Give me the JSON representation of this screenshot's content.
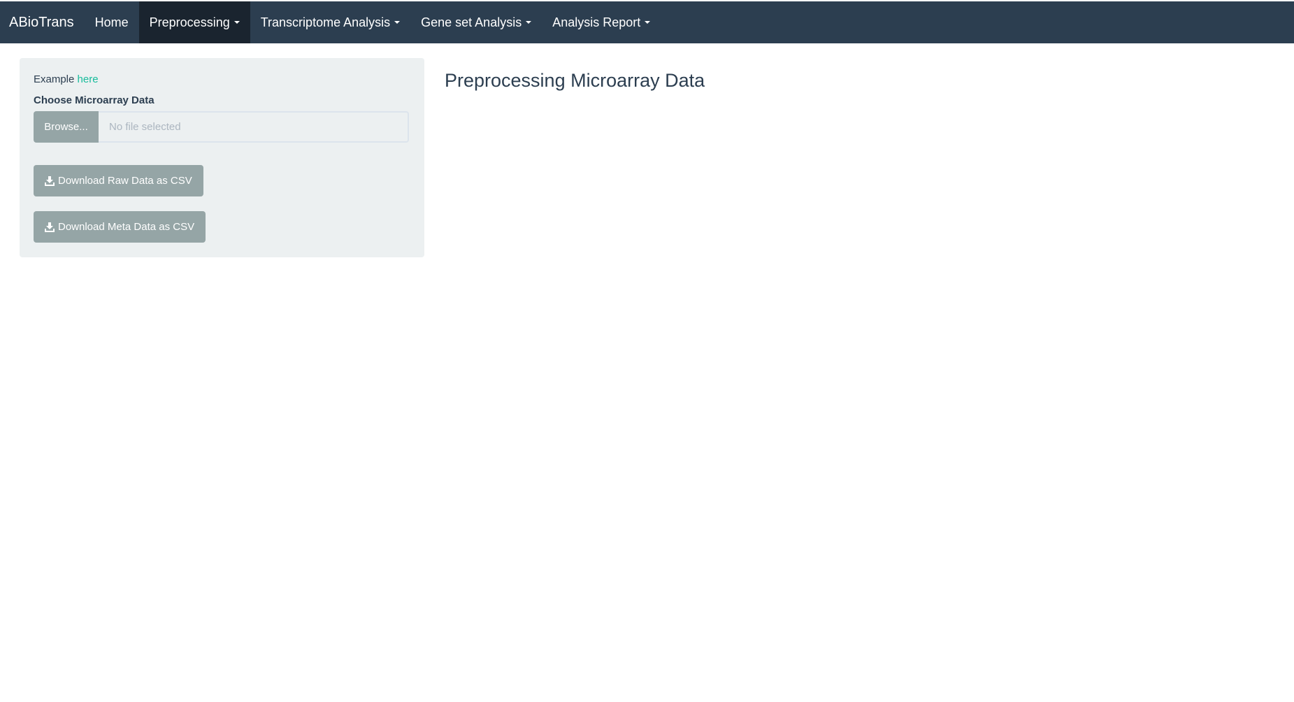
{
  "app": {
    "brand": "ABioTrans"
  },
  "nav": {
    "items": [
      {
        "label": "Home",
        "dropdown": false
      },
      {
        "label": "Preprocessing",
        "dropdown": true,
        "active": true
      },
      {
        "label": "Transcriptome Analysis",
        "dropdown": true
      },
      {
        "label": "Gene set Analysis",
        "dropdown": true
      },
      {
        "label": "Analysis Report",
        "dropdown": true
      }
    ]
  },
  "sidebar": {
    "example_prefix": "Example",
    "example_link": "here",
    "file_label": "Choose Microarray Data",
    "browse_label": "Browse...",
    "file_placeholder": "No file selected",
    "download_raw_label": "Download Raw Data as CSV",
    "download_meta_label": "Download Meta Data as CSV"
  },
  "main": {
    "title": "Preprocessing Microarray Data"
  },
  "colors": {
    "navbar": "#2c3e50",
    "navbar_active": "#1a242f",
    "well": "#ecf0f1",
    "button": "#95a5a6",
    "link": "#18bc9c"
  },
  "icons": {
    "download": "download-icon",
    "caret": "caret-down-icon"
  }
}
